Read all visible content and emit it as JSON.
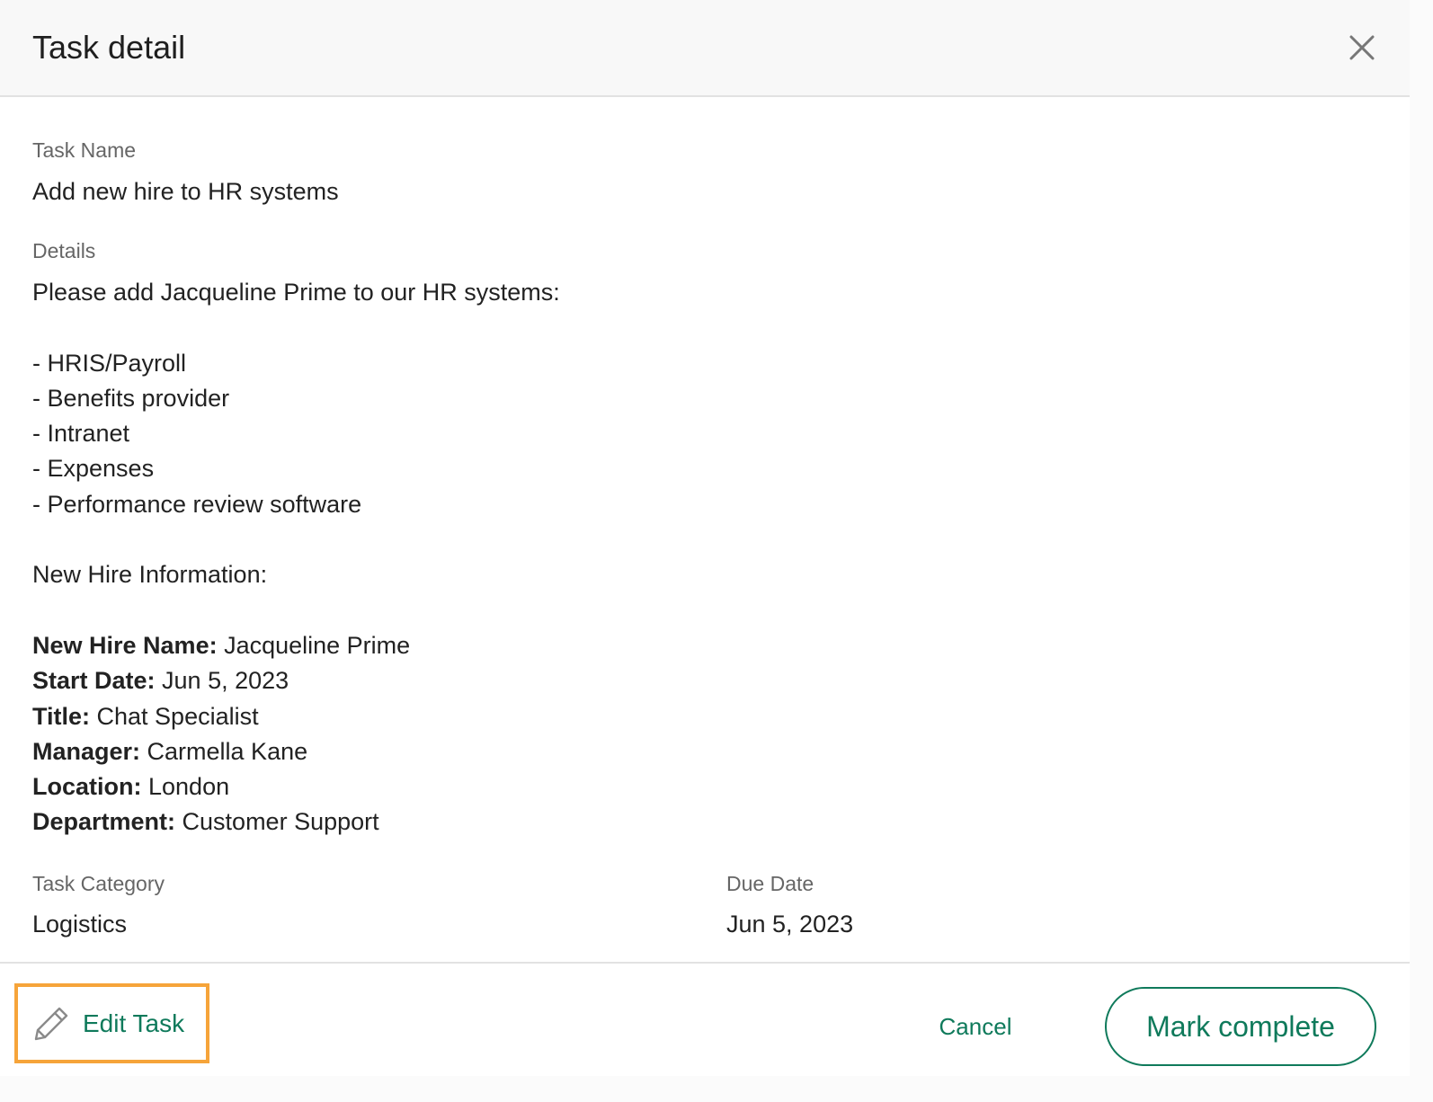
{
  "modal": {
    "title": "Task detail",
    "close_icon": "close-icon"
  },
  "task_name": {
    "label": "Task Name",
    "value": "Add new hire to HR systems"
  },
  "details": {
    "label": "Details",
    "intro": "Please add Jacqueline Prime to our HR systems:",
    "systems": [
      "- HRIS/Payroll",
      "- Benefits provider",
      "- Intranet",
      "- Expenses",
      "- Performance review software"
    ],
    "info_heading": "New Hire Information:",
    "info": [
      {
        "key": "New Hire Name:",
        "value": " Jacqueline Prime"
      },
      {
        "key": "Start Date:",
        "value": " Jun 5, 2023"
      },
      {
        "key": "Title:",
        "value": " Chat Specialist"
      },
      {
        "key": "Manager:",
        "value": " Carmella Kane"
      },
      {
        "key": "Location:",
        "value": " London"
      },
      {
        "key": "Department:",
        "value": " Customer Support"
      }
    ]
  },
  "task_category": {
    "label": "Task Category",
    "value": "Logistics"
  },
  "due_date": {
    "label": "Due Date",
    "value": "Jun 5, 2023"
  },
  "footer": {
    "edit_label": "Edit Task",
    "edit_icon": "pencil-icon",
    "cancel_label": "Cancel",
    "complete_label": "Mark complete"
  },
  "colors": {
    "accent": "#0f7a5b",
    "highlight": "#f6a43a",
    "header_bg": "#f8f8f8"
  }
}
